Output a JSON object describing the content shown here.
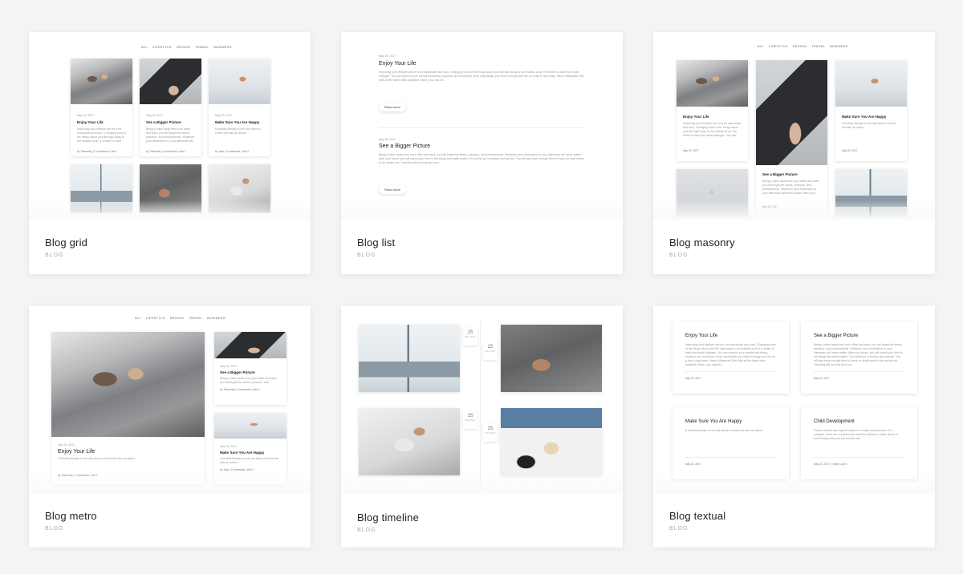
{
  "cards": [
    {
      "title": "Blog grid",
      "category": "BLOG"
    },
    {
      "title": "Blog list",
      "category": "BLOG"
    },
    {
      "title": "Blog masonry",
      "category": "BLOG"
    },
    {
      "title": "Blog metro",
      "category": "BLOG"
    },
    {
      "title": "Blog timeline",
      "category": "BLOG"
    },
    {
      "title": "Blog textual",
      "category": "BLOG"
    }
  ],
  "filters": [
    "ALL",
    "LIFESTYLE",
    "DESIGN",
    "TRAVEL",
    "BUSINESS"
  ],
  "posts": {
    "enjoy": {
      "title": "Enjoy Your Life",
      "date": "May 20, 2017",
      "excerpt": "Improving your lifestyle can be a bit impossible and hard. Changing most of the things about your life right away is not realistic at all. It is better to start from small changes. You can improve your mental well-being, physical, and emotional. Most importantly, you need to enjoy your life on a day to day basis. Have a Balanced Diet With all the latest diets available online, you may be...",
      "meta": "by Themeisly | 0 comments | Like 1"
    },
    "bigger": {
      "title": "See a Bigger Picture",
      "date": "May 20, 2017",
      "excerpt": "Being a miles away from your office and work, you will forget the stress, pressure, and predicaments. Whatever your destination is, your dilemmas will never matter. After your travel, you will spend your time to the things that really matter. You will let go of anxiety and worries. You will also have enough time to focus on what needs to be carried out. Traveling will not only give you...",
      "meta": "by Themeisly | 0 comments | Like 1"
    },
    "happy": {
      "title": "Make Sure You Are Happy",
      "date": "May 20, 2017",
      "excerpt": "A healthy lifestyle is not only about a choice but also an action.",
      "meta": "by Jane | 0 comments | Like 0"
    },
    "child": {
      "title": "Child Development",
      "date": "May 20, 2017",
      "excerpt": "Culture indeed has a great impact in a child's development. For example, there are countries who expects children to sleep alone or even though they are just months old.",
      "meta": "May 20, 2017 | Travel | Like 0"
    }
  },
  "read_more": "Read more",
  "timeline": [
    {
      "day": "25",
      "month": "May 2017"
    },
    {
      "day": "25",
      "month": "May 2017"
    },
    {
      "day": "25",
      "month": "May 2017"
    },
    {
      "day": "25",
      "month": "May 2017"
    }
  ]
}
